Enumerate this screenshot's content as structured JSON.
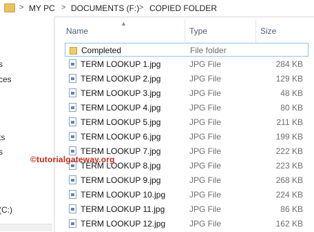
{
  "breadcrumb": {
    "items": [
      "MY PC",
      "DOCUMENTS (F:)",
      "COPIED FOLDER"
    ],
    "separator": ">"
  },
  "nav": {
    "items": [
      "s",
      "ces",
      "ts",
      "s",
      "(C:)"
    ]
  },
  "columns": {
    "name": "Name",
    "type": "Type",
    "size": "Size"
  },
  "files": [
    {
      "name": "Completed",
      "type": "File folder",
      "size": "",
      "icon": "folder-icon"
    },
    {
      "name": "TERM LOOKUP 1.jpg",
      "type": "JPG File",
      "size": "284 KB",
      "icon": "jpg-file-icon"
    },
    {
      "name": "TERM LOOKUP 2.jpg",
      "type": "JPG File",
      "size": "129 KB",
      "icon": "jpg-file-icon"
    },
    {
      "name": "TERM LOOKUP 3.jpg",
      "type": "JPG File",
      "size": "48 KB",
      "icon": "jpg-file-icon"
    },
    {
      "name": "TERM LOOKUP 4.jpg",
      "type": "JPG File",
      "size": "80 KB",
      "icon": "jpg-file-icon"
    },
    {
      "name": "TERM LOOKUP 5.jpg",
      "type": "JPG File",
      "size": "211 KB",
      "icon": "jpg-file-icon"
    },
    {
      "name": "TERM LOOKUP 6.jpg",
      "type": "JPG File",
      "size": "199 KB",
      "icon": "jpg-file-icon"
    },
    {
      "name": "TERM LOOKUP 7.jpg",
      "type": "JPG File",
      "size": "222 KB",
      "icon": "jpg-file-icon"
    },
    {
      "name": "TERM LOOKUP 8.jpg",
      "type": "JPG File",
      "size": "223 KB",
      "icon": "jpg-file-icon"
    },
    {
      "name": "TERM LOOKUP 9.jpg",
      "type": "JPG File",
      "size": "268 KB",
      "icon": "jpg-file-icon"
    },
    {
      "name": "TERM LOOKUP 10.jpg",
      "type": "JPG File",
      "size": "224 KB",
      "icon": "jpg-file-icon"
    },
    {
      "name": "TERM LOOKUP 11.jpg",
      "type": "JPG File",
      "size": "86 KB",
      "icon": "jpg-file-icon"
    },
    {
      "name": "TERM LOOKUP 12.jpg",
      "type": "JPG File",
      "size": "162 KB",
      "icon": "jpg-file-icon"
    }
  ],
  "watermark": "©tutorialgateway.org",
  "colors": {
    "watermark": "#c0281d",
    "header_text": "#4c607a",
    "selection_border": "#8ec4ec",
    "folder": "#f0cc6a"
  }
}
